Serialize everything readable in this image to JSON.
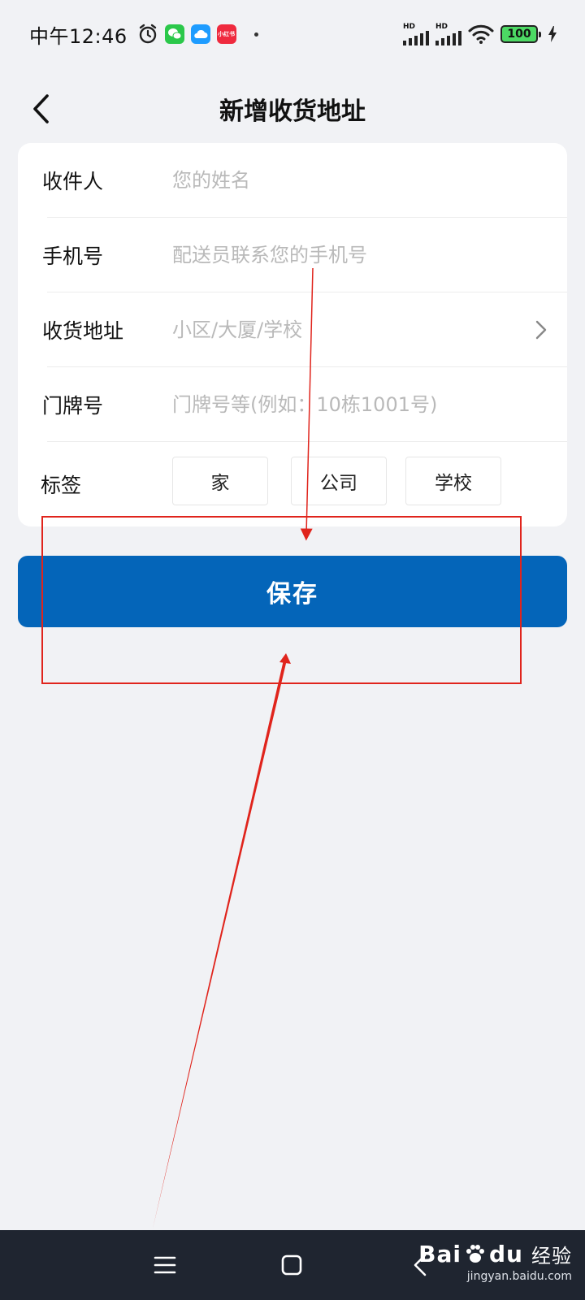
{
  "status_bar": {
    "time": "中午12:46",
    "apps": [
      {
        "name": "wechat",
        "color": "#2bc84a"
      },
      {
        "name": "cloud",
        "color": "#1e9cff"
      },
      {
        "name": "xiaohongshu",
        "color": "#ef2a3e",
        "text": "小红书"
      }
    ],
    "signal_label_1": "HD",
    "signal_label_2": "HD",
    "battery": "100"
  },
  "header": {
    "title": "新增收货地址"
  },
  "form": {
    "recipient": {
      "label": "收件人",
      "placeholder": "您的姓名",
      "value": ""
    },
    "phone": {
      "label": "手机号",
      "placeholder": "配送员联系您的手机号",
      "value": ""
    },
    "address": {
      "label": "收货地址",
      "placeholder": "小区/大厦/学校",
      "value": ""
    },
    "door": {
      "label": "门牌号",
      "placeholder": "门牌号等(例如：10栋1001号)",
      "value": ""
    },
    "tags": {
      "label": "标签",
      "options": [
        "家",
        "公司",
        "学校"
      ]
    }
  },
  "save": {
    "label": "保存"
  },
  "nav": {
    "watermark_brand": "Bai",
    "watermark_brand_tail": "du",
    "watermark_cn": "经验",
    "watermark_url": "jingyan.baidu.com"
  },
  "colors": {
    "primary": "#0465b9",
    "annotation": "#e0241c",
    "background": "#f1f2f5"
  }
}
